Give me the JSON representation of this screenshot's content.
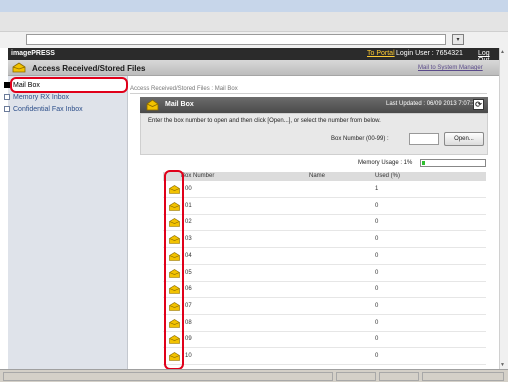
{
  "app": {
    "title": "imagePRESS",
    "to_portal": "To Portal",
    "login_user": "Login User : 7654321",
    "logout": "Log Out"
  },
  "subheader": {
    "title": "Access Received/Stored Files",
    "mail_to_system": "Mail to System Manager"
  },
  "sidebar": {
    "items": [
      {
        "label": "Mail Box"
      },
      {
        "label": "Memory RX Inbox"
      },
      {
        "label": "Confidential Fax Inbox"
      }
    ]
  },
  "breadcrumb": "Access Received/Stored Files : Mail Box",
  "panel": {
    "title": "Mail Box",
    "last_updated": "Last Updated : 06/09 2013 7:07:13",
    "instructions": "Enter the box number to open and then click [Open...], or select the number from below.",
    "box_number_label": "Box Number (00-99) :",
    "box_number_value": "",
    "open_button": "Open..."
  },
  "memory": {
    "label": "Memory Usage : 1%",
    "percent": 1
  },
  "table": {
    "headers": [
      "Box Number",
      "Name",
      "Used (%)"
    ],
    "rows": [
      {
        "number": "00",
        "name": "",
        "used": "1"
      },
      {
        "number": "01",
        "name": "",
        "used": "0"
      },
      {
        "number": "02",
        "name": "",
        "used": "0"
      },
      {
        "number": "03",
        "name": "",
        "used": "0"
      },
      {
        "number": "04",
        "name": "",
        "used": "0"
      },
      {
        "number": "05",
        "name": "",
        "used": "0"
      },
      {
        "number": "06",
        "name": "",
        "used": "0"
      },
      {
        "number": "07",
        "name": "",
        "used": "0"
      },
      {
        "number": "08",
        "name": "",
        "used": "0"
      },
      {
        "number": "09",
        "name": "",
        "used": "0"
      },
      {
        "number": "10",
        "name": "",
        "used": "0"
      }
    ]
  },
  "icons": {
    "header": "mailbox-icon",
    "panel": "mailbox-icon",
    "row": "box-icon",
    "refresh": "refresh-icon"
  },
  "colors": {
    "header_bg": "#2b2b2b",
    "portal_link": "#ffcc33",
    "highlight": "#e0001a",
    "memory_fill": "#2fbf2f",
    "icon_yellow": "#f2c200"
  }
}
